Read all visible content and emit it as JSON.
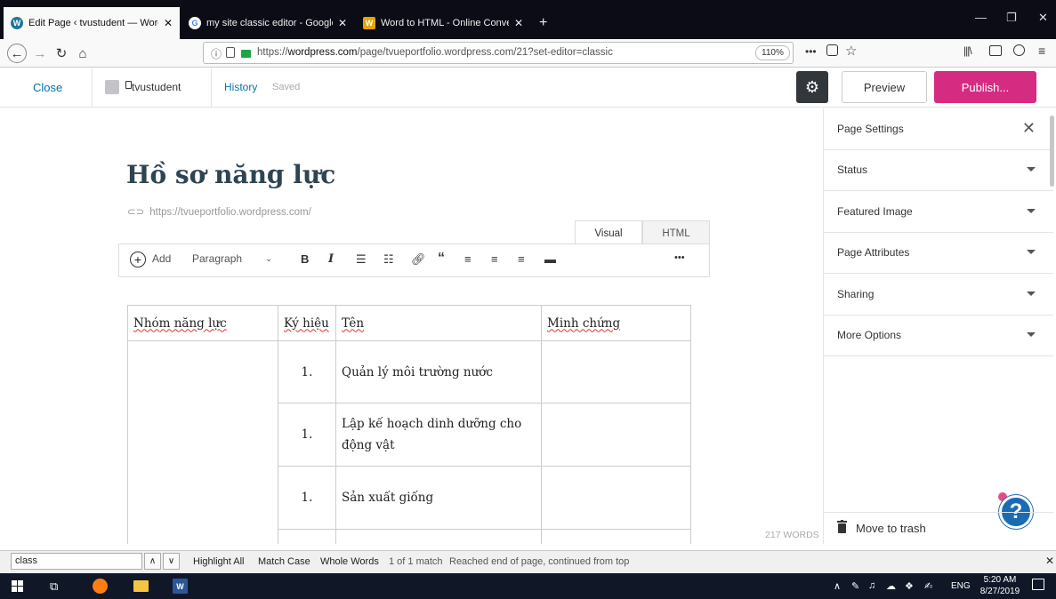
{
  "browser": {
    "tabs": [
      {
        "title": "Edit Page ‹ tvustudent — Word",
        "active": true,
        "favicon": "wordpress-icon"
      },
      {
        "title": "my site classic editor - Google",
        "active": false,
        "favicon": "google-icon"
      },
      {
        "title": "Word to HTML - Online Conve",
        "active": false,
        "favicon": "w-icon"
      }
    ],
    "new_tab": "+",
    "url_prefix": "https://",
    "url_domain": "wordpress.com",
    "url_path": "/page/tvueportfolio.wordpress.com/21?set-editor=classic",
    "zoom": "110%"
  },
  "wp": {
    "close": "Close",
    "site_name": "tvustudent",
    "history": "History",
    "saved": "Saved",
    "preview": "Preview",
    "publish": "Publish...",
    "accent": "#d52c82"
  },
  "editor": {
    "title": "Hồ sơ năng lực",
    "permalink": "https://tvueportfolio.wordpress.com/",
    "tab_visual": "Visual",
    "tab_html": "HTML",
    "toolbar": {
      "add": "Add",
      "format": "Paragraph",
      "bold": "B",
      "italic": "I",
      "more": "•••"
    },
    "table": {
      "headers": [
        "Nhóm năng lực",
        "Ký hiệu",
        "Tên",
        "Minh chứng"
      ],
      "rows": [
        {
          "num": "1.",
          "name": "Quản lý môi trường nước"
        },
        {
          "num": "1.",
          "name": "Lập kế hoạch dinh dưỡng cho động vật"
        },
        {
          "num": "1.",
          "name": "Sản xuất giống"
        }
      ]
    },
    "word_count": "217 WORDS"
  },
  "sidebar": {
    "title": "Page Settings",
    "sections": [
      "Status",
      "Featured Image",
      "Page Attributes",
      "Sharing",
      "More Options"
    ],
    "trash": "Move to trash"
  },
  "findbar": {
    "query": "class",
    "highlight_all": "Highlight All",
    "match_case": "Match Case",
    "whole_words": "Whole Words",
    "status": "1 of 1 match",
    "message": "Reached end of page, continued from top"
  },
  "taskbar": {
    "lang": "ENG",
    "time": "5:20 AM",
    "date": "8/27/2019"
  }
}
